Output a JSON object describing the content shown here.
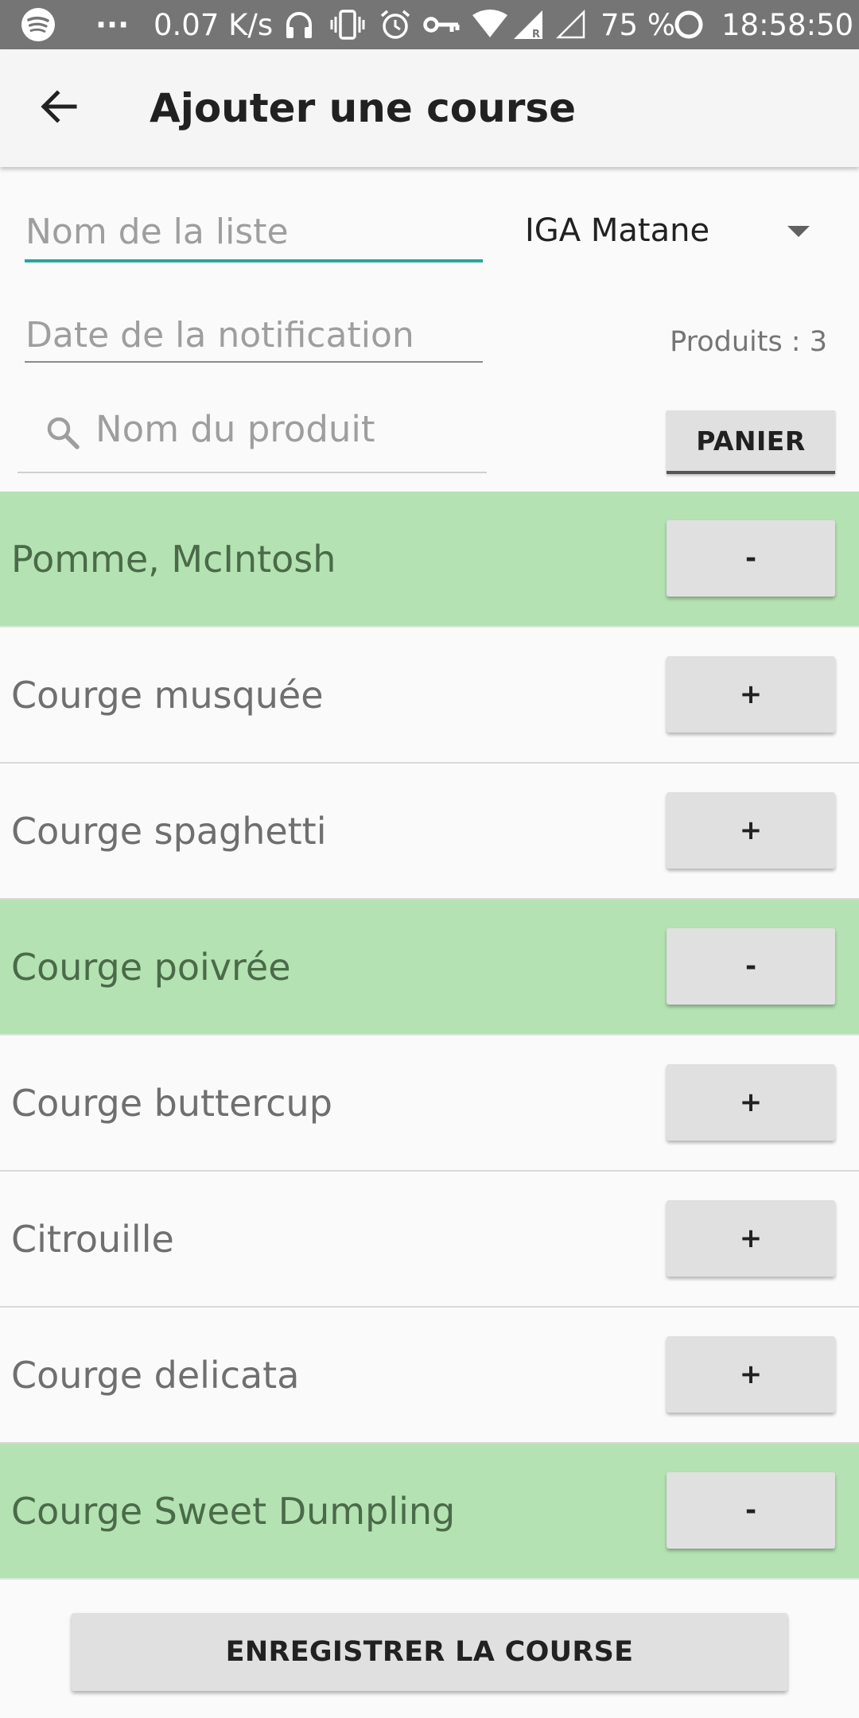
{
  "status_bar": {
    "app_icon": "spotify-icon",
    "overflow": "···",
    "net_speed": "0.07 K/s",
    "icons": [
      "headphones-icon",
      "vibrate-icon",
      "alarm-icon",
      "vpn-key-icon",
      "wifi-icon",
      "signal-roaming-icon",
      "signal-empty-icon"
    ],
    "battery_percent": "75 %",
    "battery_icon": "battery-ring-icon",
    "time": "18:58:50"
  },
  "app_bar": {
    "back_icon": "arrow-back-icon",
    "title": "Ajouter une course"
  },
  "form": {
    "list_name_placeholder": "Nom de la liste",
    "store_selected": "IGA  Matane",
    "notification_date_placeholder": "Date de la notification",
    "product_count": "Produits : 3",
    "search_placeholder": "Nom du produit",
    "search_icon": "search-icon",
    "cart_button": "PANIER",
    "accent_color": "#26a69a"
  },
  "products": [
    {
      "name": "Pomme, McIntosh",
      "in_list": true,
      "action": "-"
    },
    {
      "name": "Courge musquée",
      "in_list": false,
      "action": "+"
    },
    {
      "name": "Courge spaghetti",
      "in_list": false,
      "action": "+"
    },
    {
      "name": "Courge poivrée",
      "in_list": true,
      "action": "-"
    },
    {
      "name": "Courge buttercup",
      "in_list": false,
      "action": "+"
    },
    {
      "name": "Citrouille",
      "in_list": false,
      "action": "+"
    },
    {
      "name": "Courge delicata",
      "in_list": false,
      "action": "+"
    },
    {
      "name": "Courge Sweet Dumpling",
      "in_list": true,
      "action": "-"
    }
  ],
  "colors": {
    "in_list_row": "#b4e2b2",
    "status_bar": "#757575"
  },
  "save_button": "ENREGISTRER LA COURSE"
}
